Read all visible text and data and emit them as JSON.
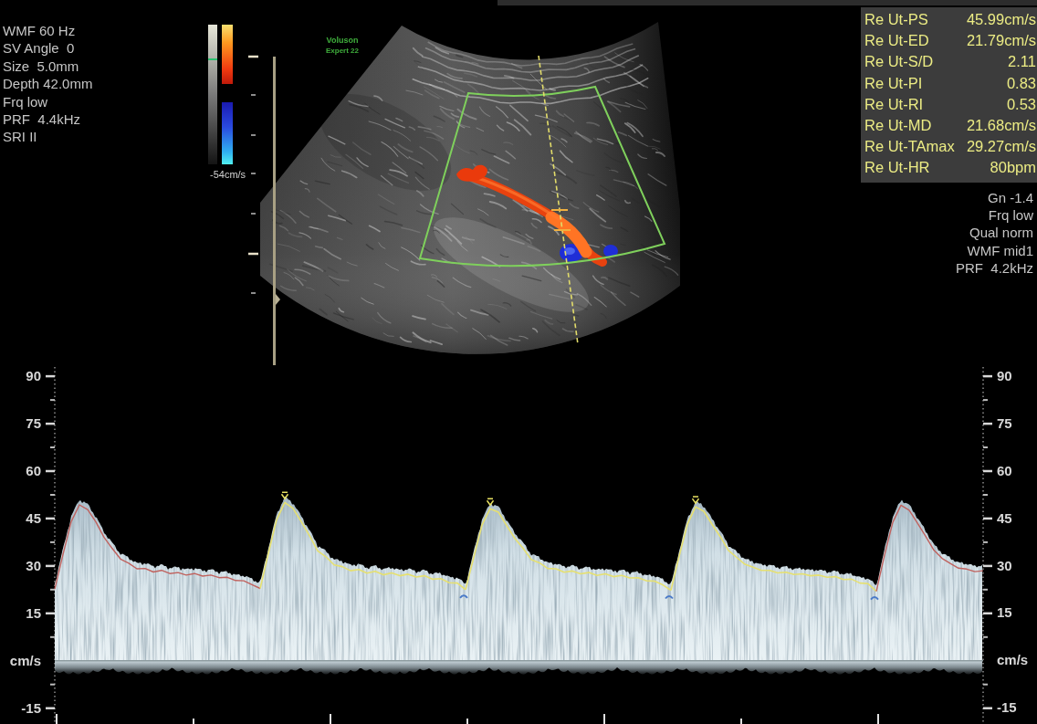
{
  "left_parameters": [
    "WMF 60 Hz",
    "SV Angle  0",
    "Size  5.0mm",
    "Depth 42.0mm",
    "Frq low",
    "PRF  4.4kHz",
    "SRI II"
  ],
  "color_scale": {
    "min_label": "-54cm/s"
  },
  "logo": {
    "brand": "Voluson",
    "model": "Expert 22"
  },
  "measurements": [
    {
      "label": "Re Ut-PS",
      "value": "45.99cm/s"
    },
    {
      "label": "Re Ut-ED",
      "value": "21.79cm/s"
    },
    {
      "label": "Re Ut-S/D",
      "value": "2.11"
    },
    {
      "label": "Re Ut-PI",
      "value": "0.83"
    },
    {
      "label": "Re Ut-RI",
      "value": "0.53"
    },
    {
      "label": "Re Ut-MD",
      "value": "21.68cm/s"
    },
    {
      "label": "Re Ut-TAmax",
      "value": "29.27cm/s"
    },
    {
      "label": "Re Ut-HR",
      "value": "80bpm"
    }
  ],
  "right_parameters": [
    "Gn -1.4",
    "Frq low",
    "Qual norm",
    "WMF mid1",
    "PRF  4.2kHz"
  ],
  "spectrum": {
    "chart_data": {
      "type": "line",
      "ylim": [
        -20,
        93.5
      ],
      "yticks": [
        {
          "value": 90,
          "label": "90"
        },
        {
          "value": 75,
          "label": "75"
        },
        {
          "value": 60,
          "label": "60"
        },
        {
          "value": 45,
          "label": "45"
        },
        {
          "value": 30,
          "label": "30"
        },
        {
          "value": 15,
          "label": "15"
        },
        {
          "value": 0,
          "label": "cm/s"
        },
        {
          "value": -15,
          "label": "-15"
        }
      ],
      "categories": [
        null,
        null,
        null,
        null,
        null,
        null,
        null,
        null,
        null,
        null,
        null,
        null,
        null,
        null,
        null,
        null,
        null,
        null,
        null,
        null,
        null,
        null,
        null,
        null,
        null,
        null,
        null,
        null,
        null,
        null,
        null,
        null,
        null,
        null,
        null,
        null,
        null,
        null,
        null,
        null,
        null,
        null,
        null,
        null,
        null,
        null,
        null,
        null,
        null,
        null,
        null,
        null,
        null,
        null,
        null,
        null,
        null,
        null,
        null,
        null,
        null,
        null,
        null,
        null,
        null,
        null,
        null,
        null,
        null,
        null,
        null,
        null,
        null,
        null,
        null,
        null,
        null,
        null,
        null,
        null,
        null,
        null,
        null,
        null,
        null,
        null,
        null,
        null,
        null,
        null,
        null,
        null,
        null,
        null,
        null,
        null,
        null,
        null,
        null,
        null,
        null,
        null,
        null,
        null,
        null,
        null,
        null,
        null,
        null,
        null,
        null,
        null,
        null,
        null
      ],
      "series": [
        {
          "color": "#c0625e",
          "values": [
            22.7,
            33.6,
            44,
            49.3,
            47.8,
            43.9,
            39,
            35.5,
            32.2,
            30.9,
            29.1,
            29.2,
            28.1,
            28.6,
            27.6,
            27.9,
            27.1,
            27.6,
            26.8,
            27.1,
            26.3,
            26.4,
            25.4,
            25.3,
            24.1,
            22.9,
            null,
            null,
            null,
            null,
            null,
            null,
            null,
            null,
            null,
            null,
            null,
            null,
            null,
            null,
            null,
            null,
            null,
            null,
            null,
            null,
            null,
            null,
            null,
            null,
            null,
            null,
            null,
            null,
            null,
            null,
            null,
            null,
            null,
            null,
            null,
            null,
            null,
            null,
            null,
            null,
            null,
            null,
            null,
            null,
            null,
            null,
            null,
            null,
            null,
            null,
            null,
            null,
            null,
            null,
            null,
            null,
            null,
            null,
            null,
            null,
            null,
            null,
            null,
            null,
            null,
            null,
            null,
            null,
            null,
            null,
            null,
            null,
            null,
            null,
            null,
            null,
            null,
            null,
            null,
            null,
            null,
            null,
            null,
            null,
            null,
            null,
            null,
            null
          ]
        },
        {
          "color": "#e6e070",
          "values": [
            null,
            null,
            null,
            null,
            null,
            null,
            null,
            null,
            null,
            null,
            null,
            null,
            null,
            null,
            null,
            null,
            null,
            null,
            null,
            null,
            null,
            null,
            null,
            null,
            null,
            22.9,
            34,
            44.6,
            50.1,
            48.2,
            44,
            39.6,
            34.8,
            32.9,
            30.3,
            29.8,
            28.5,
            28.9,
            27.7,
            28.3,
            27.2,
            27.8,
            26.9,
            27.4,
            26.5,
            26.9,
            25.8,
            26,
            24.7,
            24.6,
            22.5,
            null,
            null,
            null,
            null,
            null,
            null,
            null,
            null,
            null,
            null,
            null,
            null,
            null,
            null,
            null,
            null,
            null,
            null,
            null,
            null,
            null,
            null,
            null,
            null,
            null,
            null,
            null,
            null,
            null,
            null,
            null,
            null,
            null,
            null,
            null,
            null,
            null,
            null,
            null,
            null,
            null,
            null,
            null,
            null,
            null,
            null,
            null,
            null,
            null,
            null,
            null,
            null,
            null,
            null,
            null,
            null,
            null,
            null,
            null,
            null,
            null,
            null,
            null
          ]
        },
        {
          "color": "#e6e070",
          "values": [
            null,
            null,
            null,
            null,
            null,
            null,
            null,
            null,
            null,
            null,
            null,
            null,
            null,
            null,
            null,
            null,
            null,
            null,
            null,
            null,
            null,
            null,
            null,
            null,
            null,
            null,
            null,
            null,
            null,
            null,
            null,
            null,
            null,
            null,
            null,
            null,
            null,
            null,
            null,
            null,
            null,
            null,
            null,
            null,
            null,
            null,
            null,
            null,
            null,
            null,
            22.5,
            32.8,
            42.9,
            48.1,
            47,
            42.8,
            38.7,
            35.6,
            32,
            31,
            29.2,
            29.1,
            28,
            28.4,
            27.5,
            27.9,
            27,
            27.5,
            26.6,
            27,
            26.2,
            26.3,
            25.3,
            25.2,
            24,
            22.3,
            null,
            null,
            null,
            null,
            null,
            null,
            null,
            null,
            null,
            null,
            null,
            null,
            null,
            null,
            null,
            null,
            null,
            null,
            null,
            null,
            null,
            null,
            null,
            null,
            null,
            null,
            null,
            null,
            null,
            null,
            null,
            null,
            null,
            null,
            null,
            null,
            null,
            null
          ]
        },
        {
          "color": "#e6e070",
          "values": [
            null,
            null,
            null,
            null,
            null,
            null,
            null,
            null,
            null,
            null,
            null,
            null,
            null,
            null,
            null,
            null,
            null,
            null,
            null,
            null,
            null,
            null,
            null,
            null,
            null,
            null,
            null,
            null,
            null,
            null,
            null,
            null,
            null,
            null,
            null,
            null,
            null,
            null,
            null,
            null,
            null,
            null,
            null,
            null,
            null,
            null,
            null,
            null,
            null,
            null,
            null,
            null,
            null,
            null,
            null,
            null,
            null,
            null,
            null,
            null,
            null,
            null,
            null,
            null,
            null,
            null,
            null,
            null,
            null,
            null,
            null,
            null,
            null,
            null,
            null,
            22.3,
            33.1,
            43.2,
            48.7,
            47.3,
            43.2,
            39.3,
            34.9,
            32.7,
            30.5,
            29.6,
            28.6,
            28.6,
            27.8,
            28,
            27.3,
            27.5,
            26.9,
            27.1,
            26.4,
            26.6,
            25.7,
            25.8,
            24.6,
            24.4,
            22,
            null,
            null,
            null,
            null,
            null,
            null,
            null,
            null,
            null,
            null,
            null,
            null,
            null
          ]
        },
        {
          "color": "#c0625e",
          "values": [
            null,
            null,
            null,
            null,
            null,
            null,
            null,
            null,
            null,
            null,
            null,
            null,
            null,
            null,
            null,
            null,
            null,
            null,
            null,
            null,
            null,
            null,
            null,
            null,
            null,
            null,
            null,
            null,
            null,
            null,
            null,
            null,
            null,
            null,
            null,
            null,
            null,
            null,
            null,
            null,
            null,
            null,
            null,
            null,
            null,
            null,
            null,
            null,
            null,
            null,
            null,
            null,
            null,
            null,
            null,
            null,
            null,
            null,
            null,
            null,
            null,
            null,
            null,
            null,
            null,
            null,
            null,
            null,
            null,
            null,
            null,
            null,
            null,
            null,
            null,
            null,
            null,
            null,
            null,
            null,
            null,
            null,
            null,
            null,
            null,
            null,
            null,
            null,
            null,
            null,
            null,
            null,
            null,
            null,
            null,
            null,
            null,
            null,
            null,
            null,
            22,
            33.5,
            43.8,
            49.2,
            47.6,
            43.6,
            39.4,
            35,
            32.4,
            30.8,
            29.3,
            29,
            28.2,
            28.5
          ]
        }
      ]
    },
    "right_scale": [
      "90",
      "75",
      "60",
      "45",
      "30",
      "15",
      "cm/s",
      "-15"
    ],
    "cycles": [
      {
        "measured": false
      },
      {
        "measured": true
      },
      {
        "measured": true
      },
      {
        "measured": true
      },
      {
        "measured": false
      }
    ]
  }
}
